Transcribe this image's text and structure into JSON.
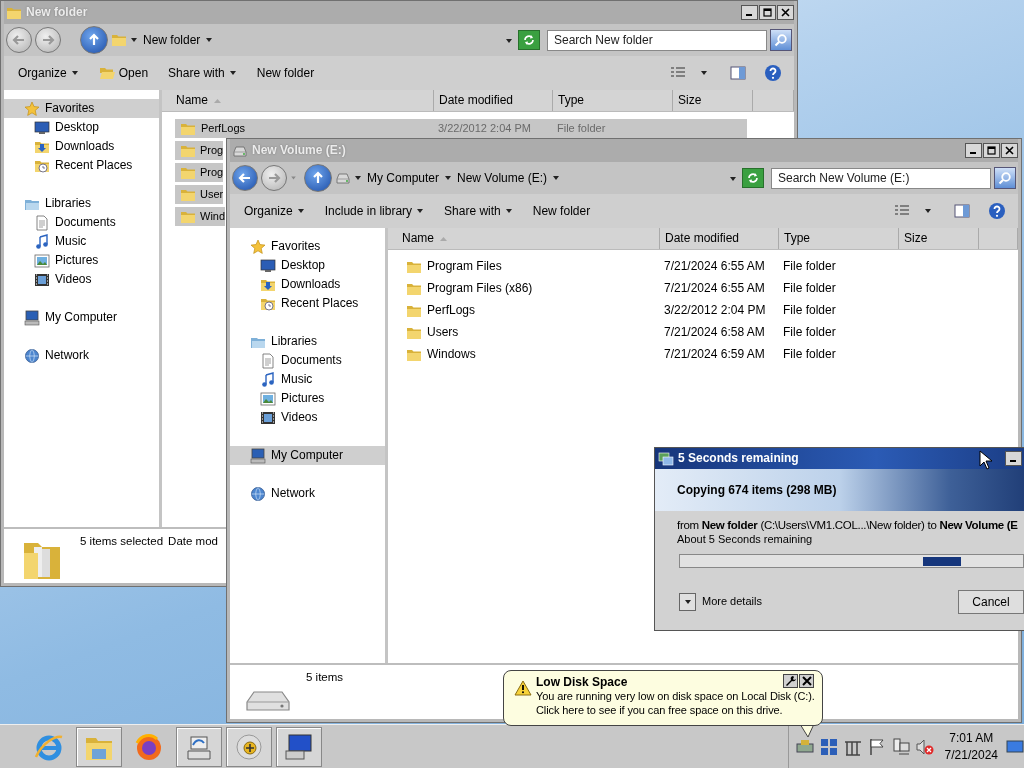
{
  "windows": [
    {
      "title": "New folder",
      "active": false,
      "address": {
        "kind": "folder",
        "back_enabled": false,
        "forward_enabled": false,
        "crumbs": [
          "New folder"
        ],
        "search_placeholder": "Search New folder"
      },
      "toolbar": [
        {
          "label": "Organize",
          "kind": "menu",
          "dropdown": true
        },
        {
          "label": "Open",
          "kind": "open",
          "dropdown": false
        },
        {
          "label": "Share with",
          "kind": "menu",
          "dropdown": true
        },
        {
          "label": "New folder",
          "kind": "menu",
          "dropdown": false
        }
      ],
      "nav": [
        {
          "label": "Favorites",
          "kind": "favorites",
          "selected": true,
          "children": [
            {
              "label": "Desktop",
              "kind": "desktop",
              "selected": false
            },
            {
              "label": "Downloads",
              "kind": "downloads",
              "selected": false
            },
            {
              "label": "Recent Places",
              "kind": "recent",
              "selected": false
            }
          ]
        },
        {
          "label": "Libraries",
          "kind": "libraries",
          "selected": false,
          "children": [
            {
              "label": "Documents",
              "kind": "documents",
              "selected": false
            },
            {
              "label": "Music",
              "kind": "music",
              "selected": false
            },
            {
              "label": "Pictures",
              "kind": "pictures",
              "selected": false
            },
            {
              "label": "Videos",
              "kind": "videos",
              "selected": false
            }
          ]
        },
        {
          "label": "My Computer",
          "kind": "computer",
          "selected": false
        },
        {
          "label": "Network",
          "kind": "network",
          "selected": false
        }
      ],
      "columns": [
        "Name",
        "Date modified",
        "Type",
        "Size"
      ],
      "files": [
        {
          "name": "PerfLogs",
          "date": "3/22/2012 2:04 PM",
          "type": "File folder",
          "selected": true
        },
        {
          "name": "Prog",
          "selected": true
        },
        {
          "name": "Prog",
          "selected": true
        },
        {
          "name": "User",
          "selected": true
        },
        {
          "name": "Wind",
          "selected": true
        }
      ],
      "details": {
        "kind": "folder",
        "text": "5 items selected",
        "extra": "Date mod"
      }
    },
    {
      "title": "New Volume (E:)",
      "active": false,
      "address": {
        "kind": "drive",
        "back_enabled": true,
        "forward_enabled": false,
        "crumbs": [
          "My Computer",
          "New Volume (E:)"
        ],
        "search_placeholder": "Search New Volume (E:)"
      },
      "toolbar": [
        {
          "label": "Organize",
          "kind": "menu",
          "dropdown": true
        },
        {
          "label": "Include in library",
          "kind": "menu",
          "dropdown": true
        },
        {
          "label": "Share with",
          "kind": "menu",
          "dropdown": true
        },
        {
          "label": "New folder",
          "kind": "menu",
          "dropdown": false
        }
      ],
      "nav": [
        {
          "label": "Favorites",
          "kind": "favorites",
          "selected": false,
          "children": [
            {
              "label": "Desktop",
              "kind": "desktop",
              "selected": false
            },
            {
              "label": "Downloads",
              "kind": "downloads",
              "selected": false
            },
            {
              "label": "Recent Places",
              "kind": "recent",
              "selected": false
            }
          ]
        },
        {
          "label": "Libraries",
          "kind": "libraries",
          "selected": false,
          "children": [
            {
              "label": "Documents",
              "kind": "documents",
              "selected": false
            },
            {
              "label": "Music",
              "kind": "music",
              "selected": false
            },
            {
              "label": "Pictures",
              "kind": "pictures",
              "selected": false
            },
            {
              "label": "Videos",
              "kind": "videos",
              "selected": false
            }
          ]
        },
        {
          "label": "My Computer",
          "kind": "computer",
          "selected": true
        },
        {
          "label": "Network",
          "kind": "network",
          "selected": false
        }
      ],
      "columns": [
        "Name",
        "Date modified",
        "Type",
        "Size"
      ],
      "files": [
        {
          "name": "Program Files",
          "date": "7/21/2024 6:55 AM",
          "type": "File folder",
          "selected": false
        },
        {
          "name": "Program Files (x86)",
          "date": "7/21/2024 6:55 AM",
          "type": "File folder",
          "selected": false
        },
        {
          "name": "PerfLogs",
          "date": "3/22/2012 2:04 PM",
          "type": "File folder",
          "selected": false
        },
        {
          "name": "Users",
          "date": "7/21/2024 6:58 AM",
          "type": "File folder",
          "selected": false
        },
        {
          "name": "Windows",
          "date": "7/21/2024 6:59 AM",
          "type": "File folder",
          "selected": false
        }
      ],
      "details": {
        "kind": "drive",
        "text": "5 items"
      }
    }
  ],
  "copy_dialog": {
    "title": "5 Seconds remaining",
    "heading": "Copying 674 items (298 MB)",
    "from_line": "from **New folder** (C:\\Users\\VM1.COL...\\New folder) to **New Volume (E**",
    "time_line": "About 5 Seconds remaining",
    "level": 0.82,
    "details_button": "More details",
    "cancel_button": "Cancel"
  },
  "balloon": {
    "title": "Low Disk Space",
    "lines": [
      "You are running very low on disk space on Local Disk (C:).",
      "Click here to see if you can free space on this drive."
    ]
  },
  "taskbar": {
    "apps": [
      {
        "kind": "browser",
        "running": false
      },
      {
        "kind": "explorer",
        "running": true
      },
      {
        "kind": "fox",
        "running": false
      },
      {
        "kind": "server",
        "running": true
      },
      {
        "kind": "orb",
        "running": true
      },
      {
        "kind": "monitor",
        "running": true
      }
    ],
    "clock": {
      "time": "7:01 AM",
      "date": "7/21/2024"
    }
  }
}
